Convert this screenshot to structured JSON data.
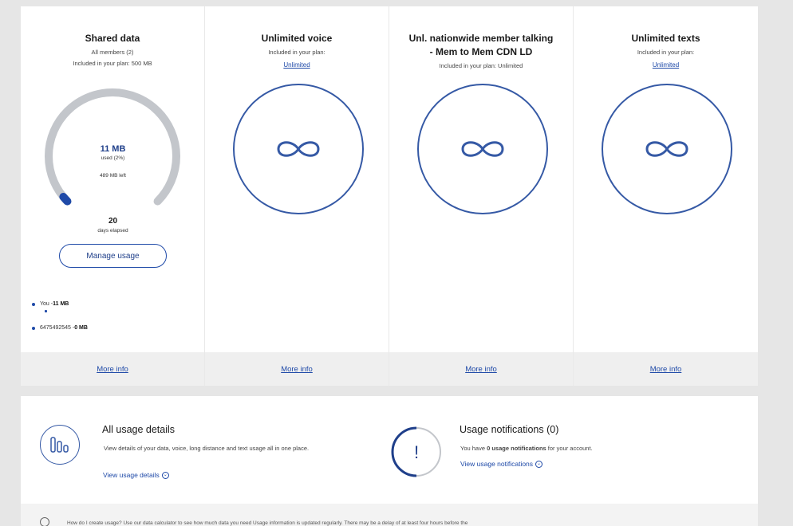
{
  "cards": [
    {
      "title": "Shared data",
      "sub1": "All members (2)",
      "sub2": "Included in your plan: 500 MB",
      "more_info": "More info"
    },
    {
      "title": "Unlimited voice",
      "sub1": "Included in your plan:",
      "link": "Unlimited",
      "more_info": "More info"
    },
    {
      "title_line1": "Unl. nationwide member talking",
      "title_line2": "- Mem to Mem CDN LD",
      "sub1": "Included in your plan: Unlimited",
      "more_info": "More info"
    },
    {
      "title": "Unlimited texts",
      "sub1": "Included in your plan:",
      "link": "Unlimited",
      "more_info": "More info"
    }
  ],
  "gauge": {
    "amount": "11 MB",
    "used_label": "used (2%)",
    "left_label": "489 MB left",
    "days": "20",
    "days_label": "days elapsed",
    "used_fraction": 0.02
  },
  "manage_usage_label": "Manage usage",
  "members": [
    {
      "name": "You - ",
      "amount": "11 MB"
    },
    {
      "name": "6475492545 - ",
      "amount": "0 MB"
    }
  ],
  "all_usage": {
    "title": "All usage details",
    "text": "View details of your data, voice, long distance and text usage all in one place.",
    "link": "View usage details"
  },
  "notifications": {
    "title": "Usage notifications (0)",
    "text_before": "You have ",
    "text_bold": "0 usage notifications",
    "text_after": " for your account.",
    "link": "View usage notifications"
  },
  "info_text": "How do I create usage? Use our data calculator to see how much data you need Usage information is updated regularly. There may be a delay of at least four hours before the",
  "colors": {
    "accent": "#1f4aa8",
    "ring": "#3559a5",
    "gauge_track": "#c3c6cb"
  }
}
